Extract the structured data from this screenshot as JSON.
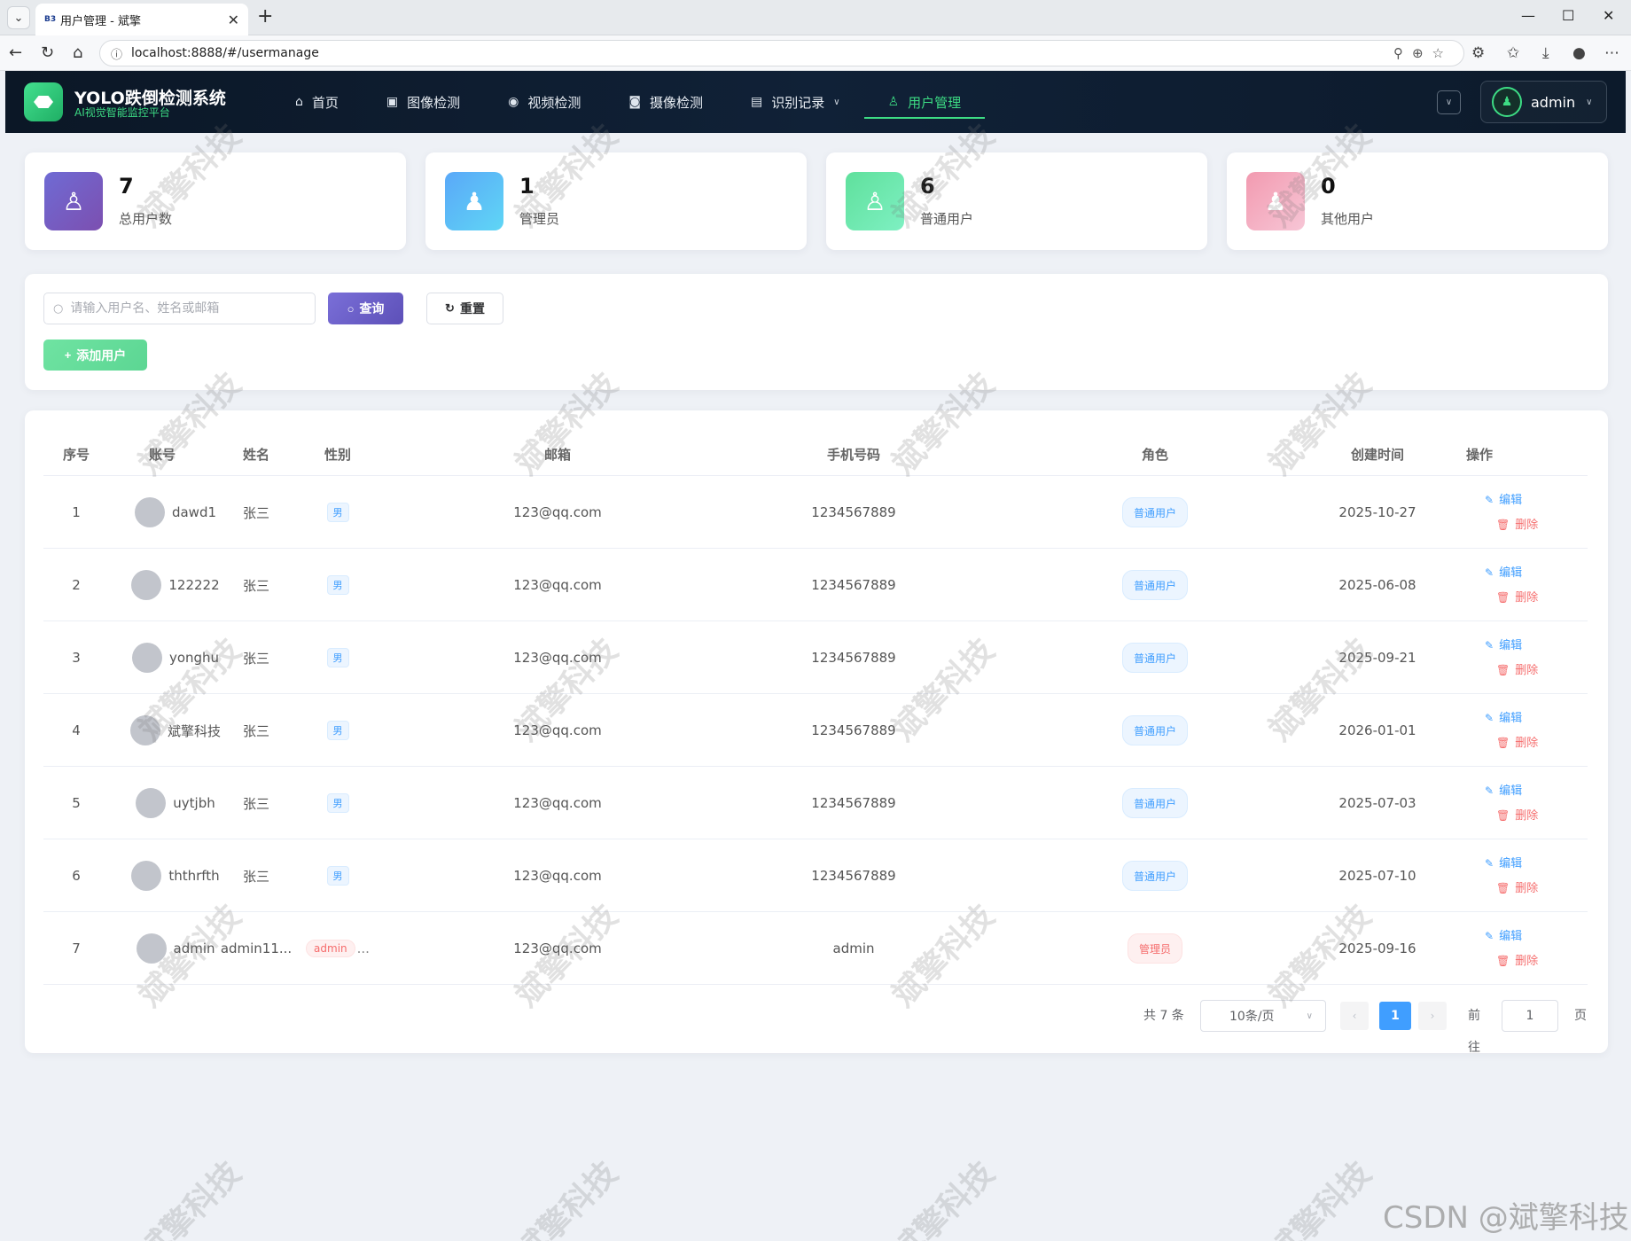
{
  "browser": {
    "tab_title": "用户管理 - 斌擎",
    "favicon_text": "B3",
    "url": "localhost:8888/#/usermanage"
  },
  "app": {
    "title": "YOLO跌倒检测系统",
    "subtitle": "AI视觉智能监控平台",
    "nav": [
      {
        "label": "首页",
        "icon": "home-icon"
      },
      {
        "label": "图像检测",
        "icon": "image-icon"
      },
      {
        "label": "视频检测",
        "icon": "video-play-icon"
      },
      {
        "label": "摄像检测",
        "icon": "camera-icon"
      },
      {
        "label": "识别记录",
        "icon": "document-icon"
      },
      {
        "label": "用户管理",
        "icon": "user-icon"
      }
    ],
    "active_nav": "用户管理",
    "user": "admin"
  },
  "stats": [
    {
      "value": "7",
      "label": "总用户数",
      "icon": "user-outline-icon",
      "color_from": "#6f6bd4",
      "color_to": "#7c4fb0"
    },
    {
      "value": "1",
      "label": "管理员",
      "icon": "user-solid-icon",
      "color_from": "#5aa8f8",
      "color_to": "#5fd6f5"
    },
    {
      "value": "6",
      "label": "普通用户",
      "icon": "user-outline-icon",
      "color_from": "#5fe09c",
      "color_to": "#7ef0c2"
    },
    {
      "value": "0",
      "label": "其他用户",
      "icon": "user-solid-icon",
      "color_from": "#f29ab0",
      "color_to": "#f7c6d6"
    }
  ],
  "search": {
    "placeholder": "请输入用户名、姓名或邮箱",
    "query_label": "查询",
    "reset_label": "重置",
    "add_label": "添加用户"
  },
  "table": {
    "columns": [
      "序号",
      "账号",
      "姓名",
      "性别",
      "邮箱",
      "手机号码",
      "角色",
      "创建时间",
      "操作"
    ],
    "edit_label": "编辑",
    "delete_label": "删除",
    "rows": [
      {
        "no": "1",
        "account": "dawd1",
        "name": "张三",
        "gender": "男",
        "email": "123@qq.com",
        "phone": "1234567889",
        "role": "普通用户",
        "created": "2025-10-27"
      },
      {
        "no": "2",
        "account": "122222",
        "name": "张三",
        "gender": "男",
        "email": "123@qq.com",
        "phone": "1234567889",
        "role": "普通用户",
        "created": "2025-06-08"
      },
      {
        "no": "3",
        "account": "yonghu",
        "name": "张三",
        "gender": "男",
        "email": "123@qq.com",
        "phone": "1234567889",
        "role": "普通用户",
        "created": "2025-09-21"
      },
      {
        "no": "4",
        "account": "斌擎科技",
        "name": "张三",
        "gender": "男",
        "email": "123@qq.com",
        "phone": "1234567889",
        "role": "普通用户",
        "created": "2026-01-01"
      },
      {
        "no": "5",
        "account": "uytjbh",
        "name": "张三",
        "gender": "男",
        "email": "123@qq.com",
        "phone": "1234567889",
        "role": "普通用户",
        "created": "2025-07-03"
      },
      {
        "no": "6",
        "account": "ththrfth",
        "name": "张三",
        "gender": "男",
        "email": "123@qq.com",
        "phone": "1234567889",
        "role": "普通用户",
        "created": "2025-07-10"
      },
      {
        "no": "7",
        "account": "admin",
        "name": "admin11...",
        "gender": "admin",
        "gender_ellipsis": "...",
        "email": "123@qq.com",
        "phone": "admin",
        "role": "管理员",
        "created": "2025-09-16"
      }
    ]
  },
  "pagination": {
    "total_text": "共 7 条",
    "page_size": "10条/页",
    "current_page": "1",
    "goto_label": "前往",
    "goto_value": "1",
    "page_suffix": "页"
  },
  "watermark": "斌擎科技",
  "csdn_mark": "CSDN @斌擎科技",
  "colors": {
    "accent_green": "#3ddc84",
    "primary_blue": "#409eff",
    "danger_red": "#f56c6c",
    "header_bg": "#0b1726"
  }
}
